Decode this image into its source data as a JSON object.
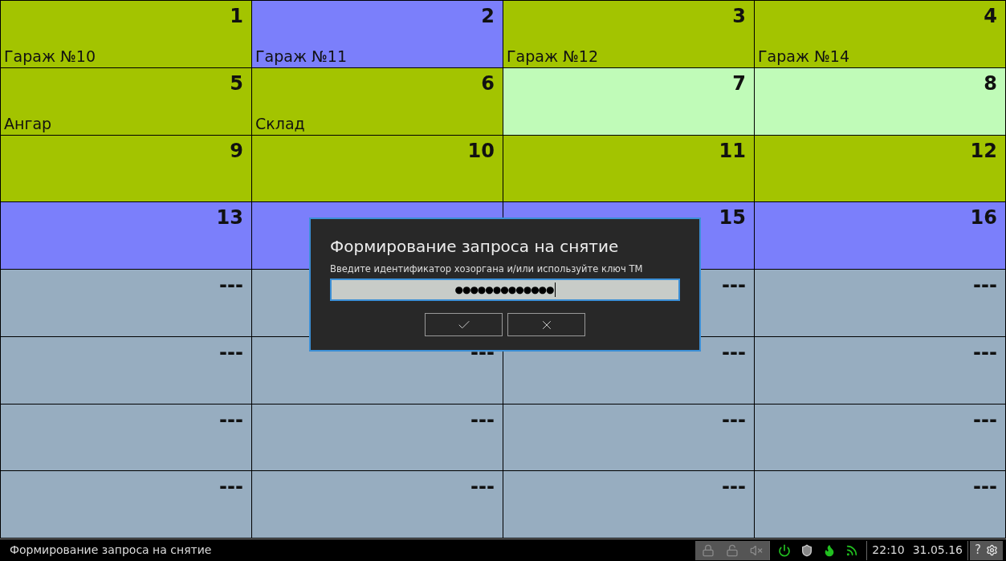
{
  "tiles": [
    {
      "number": "1",
      "name": "Гараж №10",
      "color": "#a3c400"
    },
    {
      "number": "2",
      "name": "Гараж №11",
      "color": "#7b7ffb"
    },
    {
      "number": "3",
      "name": "Гараж №12",
      "color": "#a3c400"
    },
    {
      "number": "4",
      "name": "Гараж №14",
      "color": "#a3c400"
    },
    {
      "number": "5",
      "name": "Ангар",
      "color": "#a3c400"
    },
    {
      "number": "6",
      "name": "Склад",
      "color": "#a3c400"
    },
    {
      "number": "7",
      "color": "#c0fbb8"
    },
    {
      "number": "8",
      "color": "#c0fbb8"
    },
    {
      "number": "9",
      "color": "#a3c400"
    },
    {
      "number": "10",
      "color": "#a3c400"
    },
    {
      "number": "11",
      "color": "#a3c400"
    },
    {
      "number": "12",
      "color": "#a3c400"
    },
    {
      "number": "13",
      "color": "#7b7ffb"
    },
    {
      "color": "#7b7ffb"
    },
    {
      "number": "15",
      "color": "#7b7ffb"
    },
    {
      "number": "16",
      "color": "#7b7ffb"
    },
    {
      "number": "---",
      "color": "#97adc0"
    },
    {
      "color": "#97adc0"
    },
    {
      "number": "---",
      "color": "#97adc0"
    },
    {
      "number": "---",
      "color": "#97adc0"
    },
    {
      "number": "---",
      "color": "#97adc0"
    },
    {
      "number": "---",
      "color": "#97adc0"
    },
    {
      "number": "---",
      "color": "#97adc0"
    },
    {
      "number": "---",
      "color": "#97adc0"
    },
    {
      "number": "---",
      "color": "#97adc0"
    },
    {
      "number": "---",
      "color": "#97adc0"
    },
    {
      "number": "---",
      "color": "#97adc0"
    },
    {
      "number": "---",
      "color": "#97adc0"
    },
    {
      "number": "---",
      "color": "#97adc0"
    },
    {
      "number": "---",
      "color": "#97adc0"
    },
    {
      "number": "---",
      "color": "#97adc0"
    },
    {
      "number": "---",
      "color": "#97adc0"
    }
  ],
  "dialog": {
    "title": "Формирование запроса на снятие",
    "prompt": "Введите идентификатор хозоргана и/или используйте ключ ТМ",
    "value": "●●●●●●●●●●●●●"
  },
  "status_bar": {
    "message": "Формирование запроса на снятие",
    "time": "22:10",
    "date": "31.05.16",
    "help": "?"
  }
}
